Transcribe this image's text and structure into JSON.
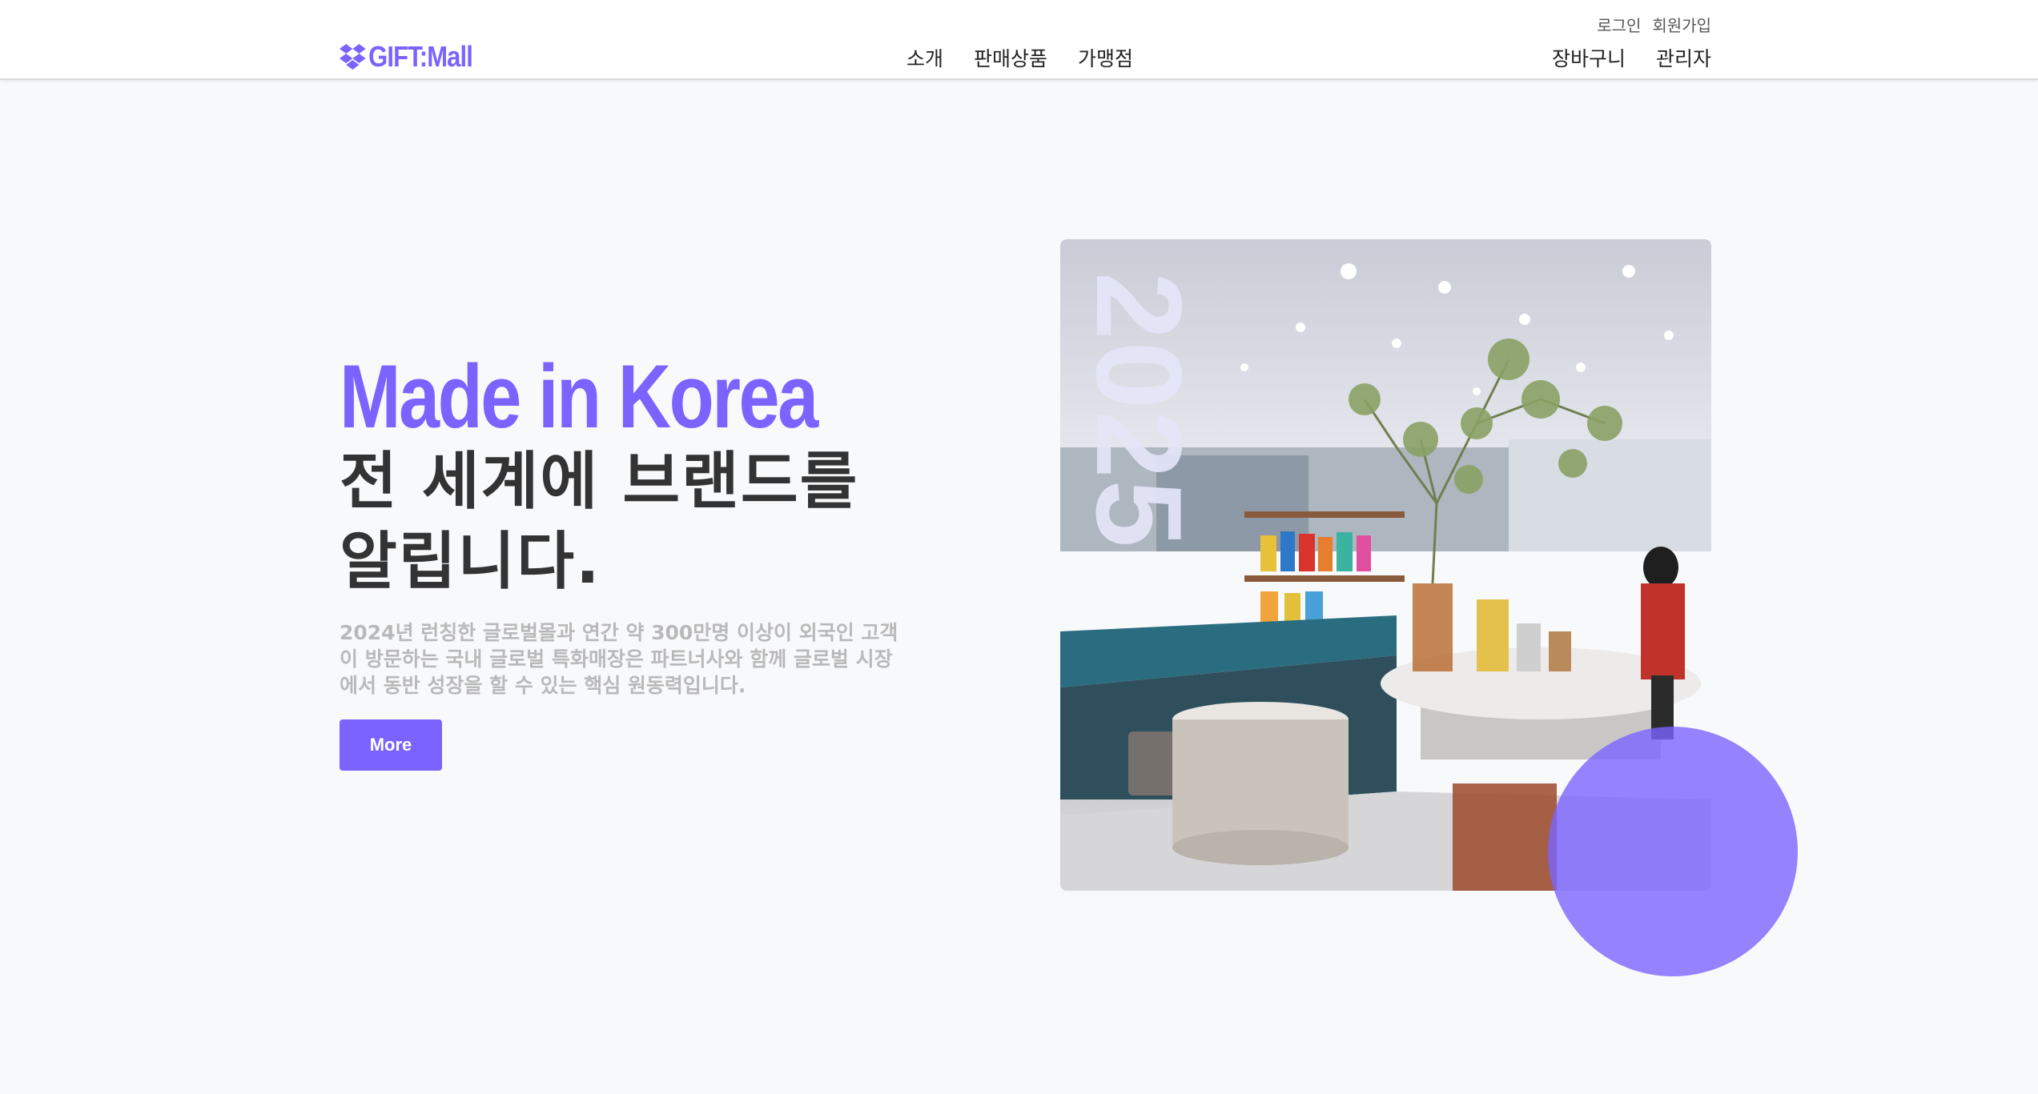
{
  "header": {
    "logo_text": "GIFT:Mall",
    "logo_icon": "dropbox-icon",
    "util_links": [
      "로그인",
      "회원가입"
    ],
    "main_nav": [
      "소개",
      "판매상품",
      "가맹점"
    ],
    "side_nav": [
      "장바구니",
      "관리자"
    ]
  },
  "hero": {
    "title": "Made in Korea",
    "subtitle_line1": "전 세계에 브랜드를",
    "subtitle_line2": "알립니다.",
    "description": "2024년 런칭한 글로벌몰과 연간 약 300만명 이상이 외국인 고객이 방문하는 국내 글로벌 특화매장은 파트너사와 함께 글로벌 시장에서 동반 성장을 할 수 있는 핵심 원동력입니다.",
    "button_label": "More",
    "image_year": "2025"
  },
  "colors": {
    "accent": "#7a63ff",
    "text_dark": "#333333",
    "text_muted": "#b9b9b9",
    "background": "#f8f9fb"
  }
}
